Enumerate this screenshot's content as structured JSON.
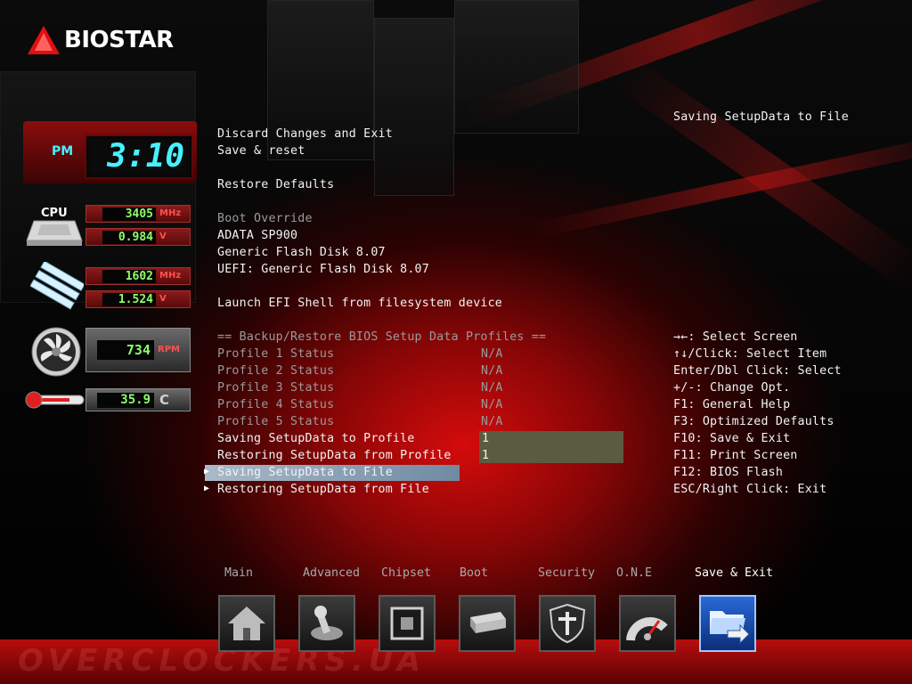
{
  "brand": {
    "logo_text": "BIOSTAR"
  },
  "clock": {
    "ampm": "PM",
    "time": "3:10"
  },
  "monitors": {
    "cpu_label": "CPU",
    "cpu_freq": {
      "value": "3405",
      "unit": "MHz"
    },
    "cpu_volt": {
      "value": "0.984",
      "unit": "V"
    },
    "mem_freq": {
      "value": "1602",
      "unit": "MHz"
    },
    "mem_volt": {
      "value": "1.524",
      "unit": "V"
    },
    "fan": {
      "value": "734",
      "unit": "RPM"
    },
    "temp": {
      "value": "35.9",
      "unit": "C"
    }
  },
  "help_title": "Saving SetupData to File",
  "menu": {
    "discard_exit": "Discard Changes and Exit",
    "save_reset": "Save & reset",
    "restore_defaults": "Restore Defaults",
    "boot_override": "Boot Override",
    "boot_devices": [
      "ADATA SP900",
      "Generic Flash Disk 8.07",
      "UEFI: Generic Flash Disk 8.07"
    ],
    "efi_shell": "Launch EFI Shell from filesystem device",
    "profiles_header": "== Backup/Restore BIOS Setup Data Profiles ==",
    "profiles": [
      {
        "label": "Profile 1 Status",
        "value": "N/A"
      },
      {
        "label": "Profile 2 Status",
        "value": "N/A"
      },
      {
        "label": "Profile 3 Status",
        "value": "N/A"
      },
      {
        "label": "Profile 4 Status",
        "value": "N/A"
      },
      {
        "label": "Profile 5 Status",
        "value": "N/A"
      }
    ],
    "save_profile": {
      "label": "Saving SetupData to Profile",
      "value": "1"
    },
    "restore_profile": {
      "label": "Restoring SetupData from Profile",
      "value": "1"
    },
    "save_file": "Saving SetupData to File",
    "restore_file": "Restoring SetupData from File"
  },
  "keys": [
    "→←: Select Screen",
    "↑↓/Click: Select Item",
    "Enter/Dbl Click: Select",
    "+/-: Change Opt.",
    "F1: General Help",
    "F3: Optimized Defaults",
    "F10: Save & Exit",
    "F11: Print Screen",
    "F12: BIOS Flash",
    "ESC/Right Click: Exit"
  ],
  "nav": {
    "tabs": [
      {
        "label": "Main",
        "icon": "home-icon"
      },
      {
        "label": "Advanced",
        "icon": "joystick-icon"
      },
      {
        "label": "Chipset",
        "icon": "chip-icon"
      },
      {
        "label": "Boot",
        "icon": "drive-icon"
      },
      {
        "label": "Security",
        "icon": "shield-icon"
      },
      {
        "label": "O.N.E",
        "icon": "gauge-icon"
      },
      {
        "label": "Save & Exit",
        "icon": "folder-exit-icon"
      }
    ],
    "active": "Save & Exit"
  },
  "watermark": "OVERCLOCKERS.UA",
  "colors": {
    "accent_red": "#d40b0b",
    "lcd_cyan": "#48f0ff",
    "lcd_green": "#8dff6a",
    "selection": "#a9b9c9",
    "value_box": "#5b5b40"
  }
}
